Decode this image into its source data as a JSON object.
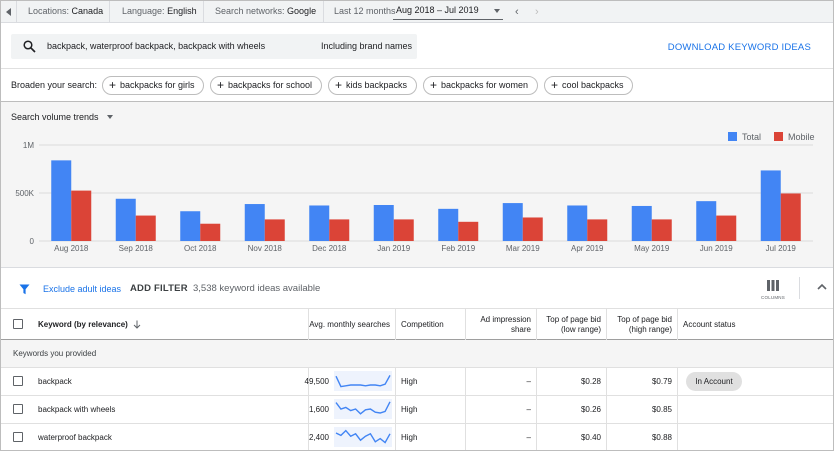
{
  "settings": {
    "locations_label": "Locations:",
    "locations_value": "Canada",
    "language_label": "Language:",
    "language_value": "English",
    "networks_label": "Search networks:",
    "networks_value": "Google",
    "period_label": "Last 12 months",
    "date_range": "Aug 2018 – Jul 2019"
  },
  "search": {
    "query": "backpack, waterproof backpack, backpack with wheels",
    "brand_toggle": "Including brand names",
    "download_label": "DOWNLOAD KEYWORD IDEAS"
  },
  "broaden": {
    "label": "Broaden your search:",
    "chips": [
      "backpacks for girls",
      "backpacks for school",
      "kids backpacks",
      "backpacks for women",
      "cool backpacks"
    ]
  },
  "trend_selector": "Search volume trends",
  "chart_data": {
    "type": "bar",
    "categories": [
      "Aug 2018",
      "Sep 2018",
      "Oct 2018",
      "Nov 2018",
      "Dec 2018",
      "Jan 2019",
      "Feb 2019",
      "Mar 2019",
      "Apr 2019",
      "May 2019",
      "Jun 2019",
      "Jul 2019"
    ],
    "series": [
      {
        "name": "Total",
        "color": "#4285f4",
        "values": [
          840000,
          440000,
          310000,
          385000,
          370000,
          375000,
          335000,
          395000,
          370000,
          365000,
          415000,
          735000
        ]
      },
      {
        "name": "Mobile",
        "color": "#db4437",
        "values": [
          525000,
          265000,
          180000,
          225000,
          225000,
          225000,
          200000,
          245000,
          225000,
          225000,
          265000,
          495000
        ]
      }
    ],
    "yticks": [
      "0",
      "500K",
      "1M"
    ],
    "ylim": [
      0,
      1000000
    ],
    "grid": true,
    "legend_position": "top-right"
  },
  "filters": {
    "exclude_adult": "Exclude adult ideas",
    "add_filter": "ADD FILTER",
    "count_text": "3,538 keyword ideas available",
    "columns_label": "COLUMNS"
  },
  "table": {
    "headers": {
      "keyword": "Keyword (by relevance)",
      "avg": "Avg. monthly searches",
      "competition": "Competition",
      "impression_line1": "Ad impression",
      "impression_line2": "share",
      "low_bid_line1": "Top of page bid",
      "low_bid_line2": "(low range)",
      "high_bid_line1": "Top of page bid",
      "high_bid_line2": "(high range)",
      "status": "Account status"
    },
    "group_label": "Keywords you provided",
    "rows": [
      {
        "keyword": "backpack",
        "avg": "49,500",
        "competition": "High",
        "impression": "–",
        "low": "$0.28",
        "high": "$0.79",
        "status": "In Account",
        "trend": [
          0.8,
          0.15,
          0.2,
          0.25,
          0.25,
          0.25,
          0.2,
          0.25,
          0.25,
          0.2,
          0.3,
          0.85
        ]
      },
      {
        "keyword": "backpack with wheels",
        "avg": "1,600",
        "competition": "High",
        "impression": "–",
        "low": "$0.26",
        "high": "$0.85",
        "status": "",
        "trend": [
          0.9,
          0.5,
          0.6,
          0.4,
          0.5,
          0.2,
          0.45,
          0.5,
          0.3,
          0.25,
          0.35,
          0.95
        ]
      },
      {
        "keyword": "waterproof backpack",
        "avg": "2,400",
        "competition": "High",
        "impression": "–",
        "low": "$0.40",
        "high": "$0.88",
        "status": "",
        "trend": [
          0.75,
          0.6,
          0.9,
          0.55,
          0.7,
          0.3,
          0.55,
          0.7,
          0.2,
          0.4,
          0.15,
          0.7
        ]
      }
    ]
  }
}
